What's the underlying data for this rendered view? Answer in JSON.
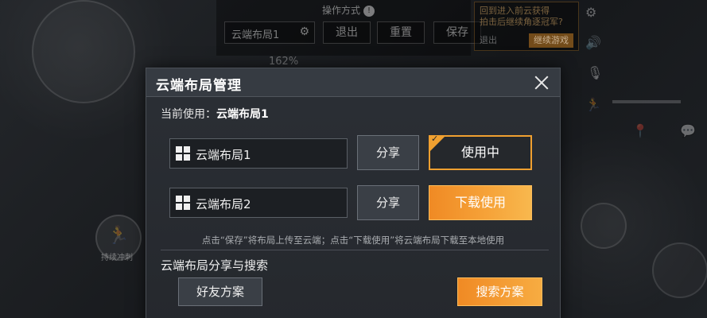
{
  "background_hud": {
    "mode_label": "操作方式",
    "layout_field": "云端布局1",
    "exit_label": "退出",
    "reset_label": "重置",
    "save_label": "保存",
    "zoom_text": "162%",
    "return_tip": "回到进入前云获得\n拍击后继续角逐冠军?",
    "return_exit": "退出",
    "return_continue": "继续游戏",
    "sprint_label": "持续冲刺"
  },
  "dialog": {
    "title": "云端布局管理",
    "current_label": "当前使用：",
    "current_value": "云端布局1",
    "layouts": [
      {
        "name": "云端布局1",
        "share_label": "分享",
        "action_label": "使用中",
        "status": "in-use"
      },
      {
        "name": "云端布局2",
        "share_label": "分享",
        "action_label": "下载使用",
        "status": "download"
      }
    ],
    "hint": "点击“保存”将布局上传至云端；点击“下载使用”将云端布局下载至本地使用",
    "section_title": "云端布局分享与搜索",
    "friend_button": "好友方案",
    "search_button": "搜索方案"
  },
  "colors": {
    "accent_orange": "#f08a24",
    "in_use_border": "#f0a030",
    "dialog_bg": "#2b2f35"
  }
}
